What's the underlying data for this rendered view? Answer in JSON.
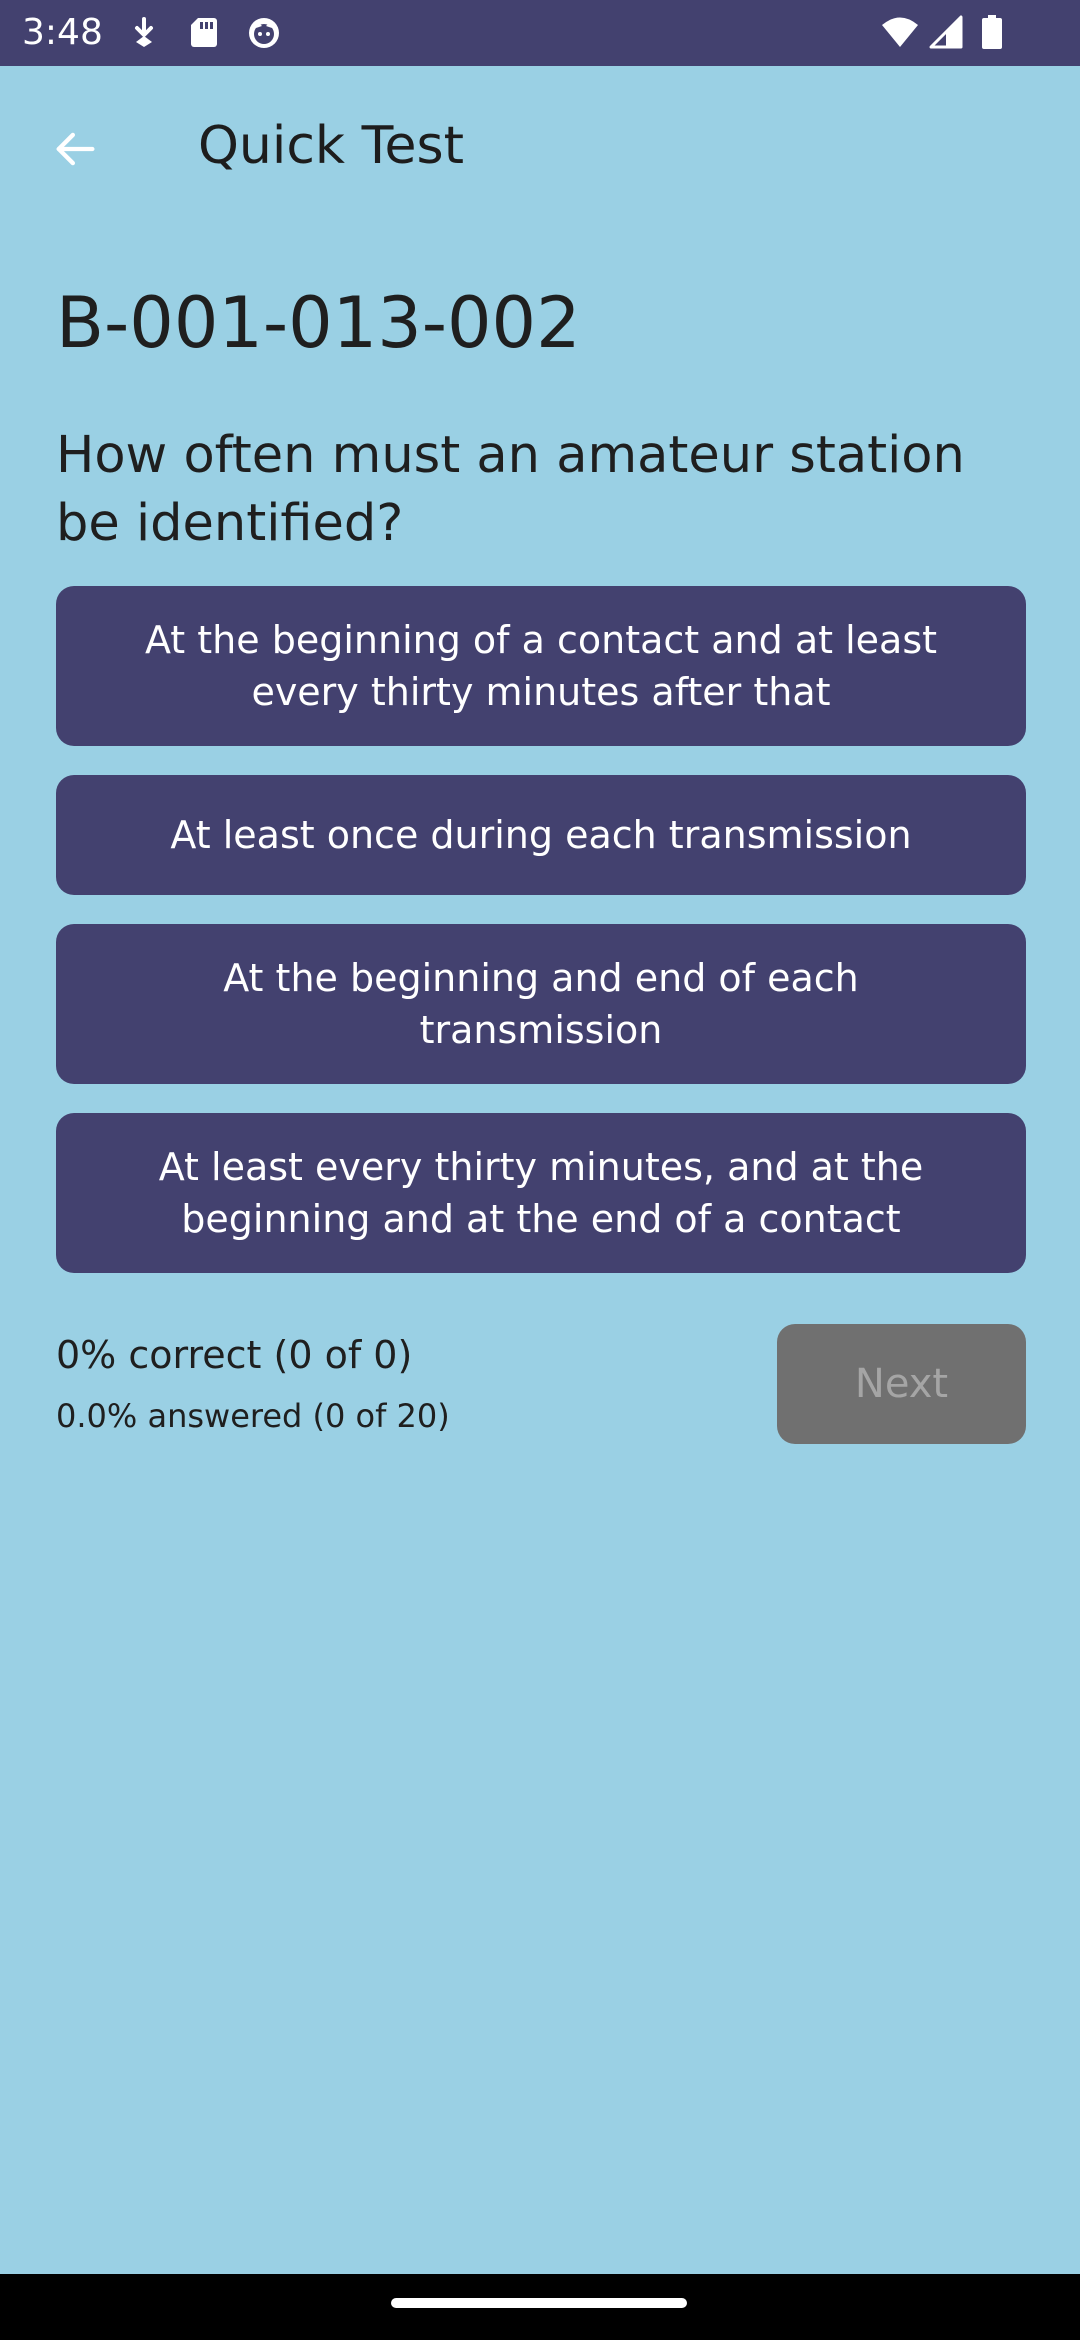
{
  "status_bar": {
    "time": "3:48",
    "left_icons": [
      "download-icon",
      "sd-card-icon",
      "cat-face-icon"
    ],
    "right_icons": [
      "wifi-icon",
      "signal-icon",
      "battery-icon"
    ],
    "background": "#43416f"
  },
  "app_bar": {
    "title": "Quick Test",
    "back_icon": "arrow-left-icon"
  },
  "question": {
    "id": "B-001-013-002",
    "text": "How often must an amateur station be identified?"
  },
  "answers": [
    {
      "label": "At the beginning of a contact and at least every thirty minutes after that"
    },
    {
      "label": "At least once during each transmission"
    },
    {
      "label": "At the beginning and end of each transmission"
    },
    {
      "label": "At least every thirty minutes, and at the beginning and at the end of a contact"
    }
  ],
  "progress": {
    "correct_text": "0% correct (0 of 0)",
    "answered_text": "0.0% answered (0 of 20)"
  },
  "next_button": {
    "label": "Next",
    "enabled": false
  },
  "colors": {
    "background": "#9ad0e4",
    "accent": "#43416f",
    "disabled": "#707070"
  }
}
